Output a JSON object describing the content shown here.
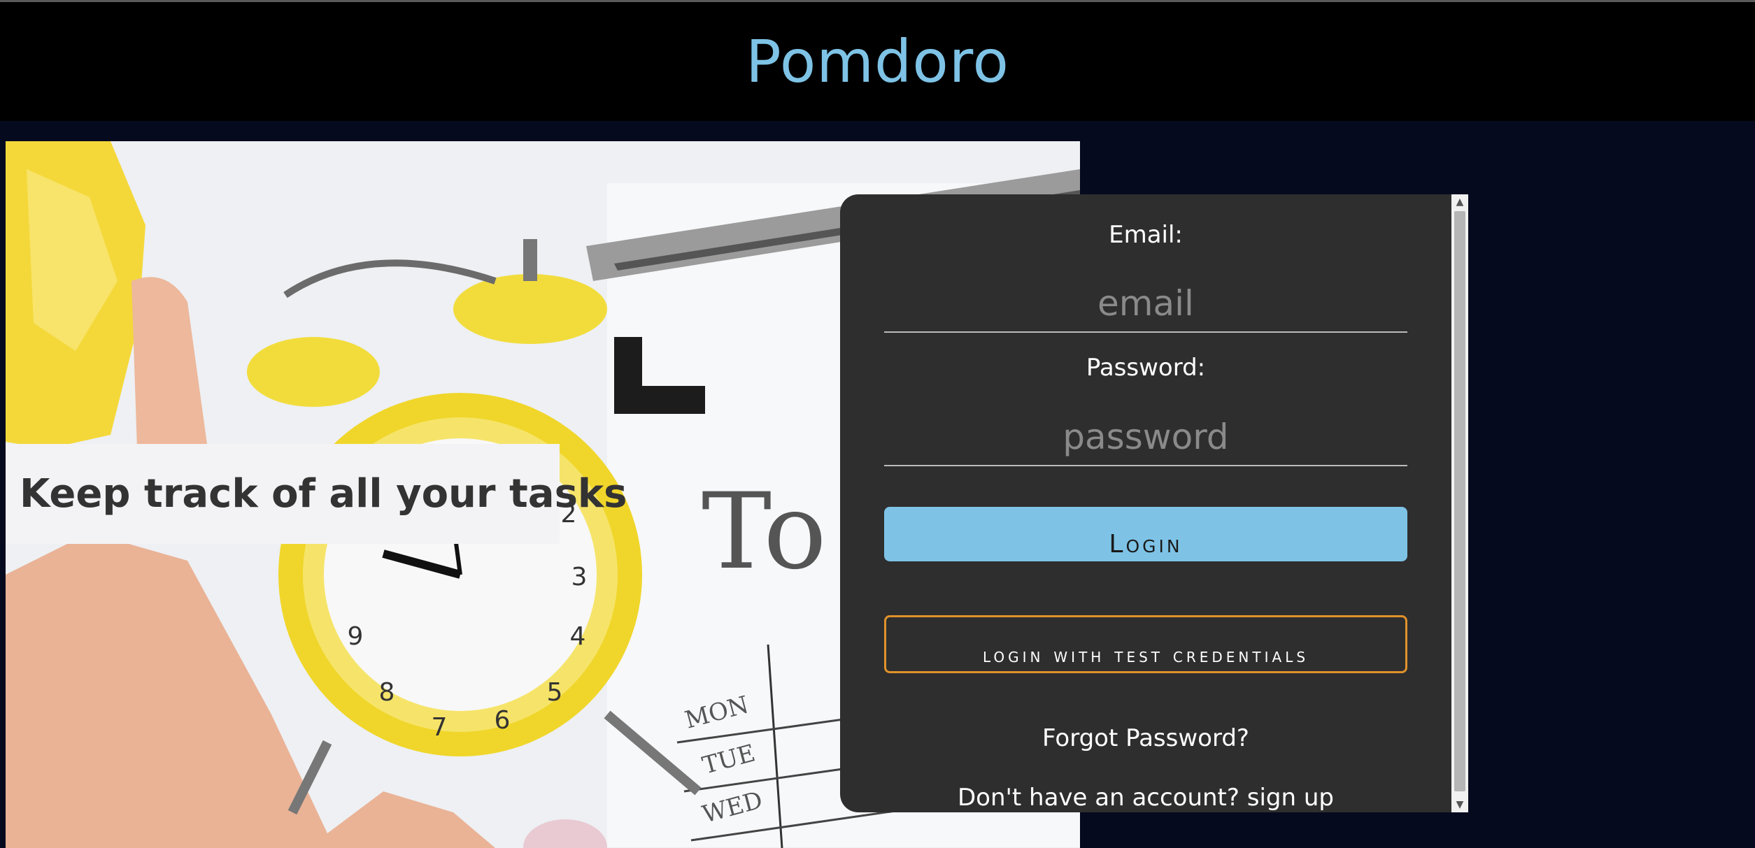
{
  "header": {
    "title": "Pomdoro"
  },
  "hero": {
    "tagline": "Keep track of all your tasks"
  },
  "login_form": {
    "email_label": "Email:",
    "email_placeholder": "email",
    "email_value": "",
    "password_label": "Password:",
    "password_placeholder": "password",
    "password_value": "",
    "login_button": "Login",
    "test_login_button": "login with test credentials",
    "forgot_password": "Forgot Password?",
    "signup_prompt": "Don't have an account? sign up"
  },
  "colors": {
    "accent": "#7ec3e6",
    "page_background": "#050a1e",
    "panel_background": "#2e2e2e",
    "test_button_border": "#e0922a"
  }
}
